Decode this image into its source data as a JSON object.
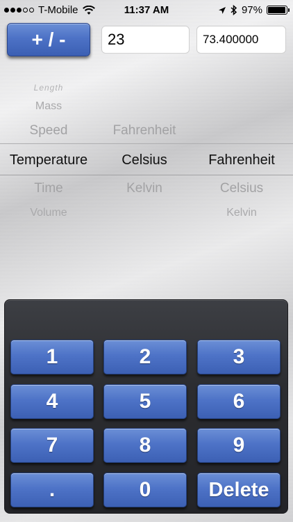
{
  "status_bar": {
    "carrier": "T-Mobile",
    "time": "11:37 AM",
    "battery": "97%",
    "battery_level": 0.97,
    "signal_bars_filled": 3,
    "signal_bars_total": 5,
    "icons": [
      "wifi-icon",
      "location-arrow-icon",
      "bluetooth-icon",
      "battery-icon"
    ]
  },
  "controls": {
    "sign_label": "+ / -",
    "input_value": "23",
    "output_value": "73.400000"
  },
  "picker": {
    "categories": [
      "Length",
      "Mass",
      "Speed",
      "Temperature",
      "Time",
      "Volume"
    ],
    "selected_category": "Temperature",
    "from_units": [
      "Fahrenheit",
      "Celsius",
      "Kelvin"
    ],
    "selected_from": "Celsius",
    "to_units": [
      "Fahrenheit",
      "Celsius",
      "Kelvin"
    ],
    "selected_to": "Fahrenheit"
  },
  "keypad": {
    "keys": [
      "1",
      "2",
      "3",
      "4",
      "5",
      "6",
      "7",
      "8",
      "9",
      ".",
      "0",
      "Delete"
    ]
  },
  "colors": {
    "button_blue": "#4d72c6",
    "keypad_dark": "#2c2d31"
  }
}
